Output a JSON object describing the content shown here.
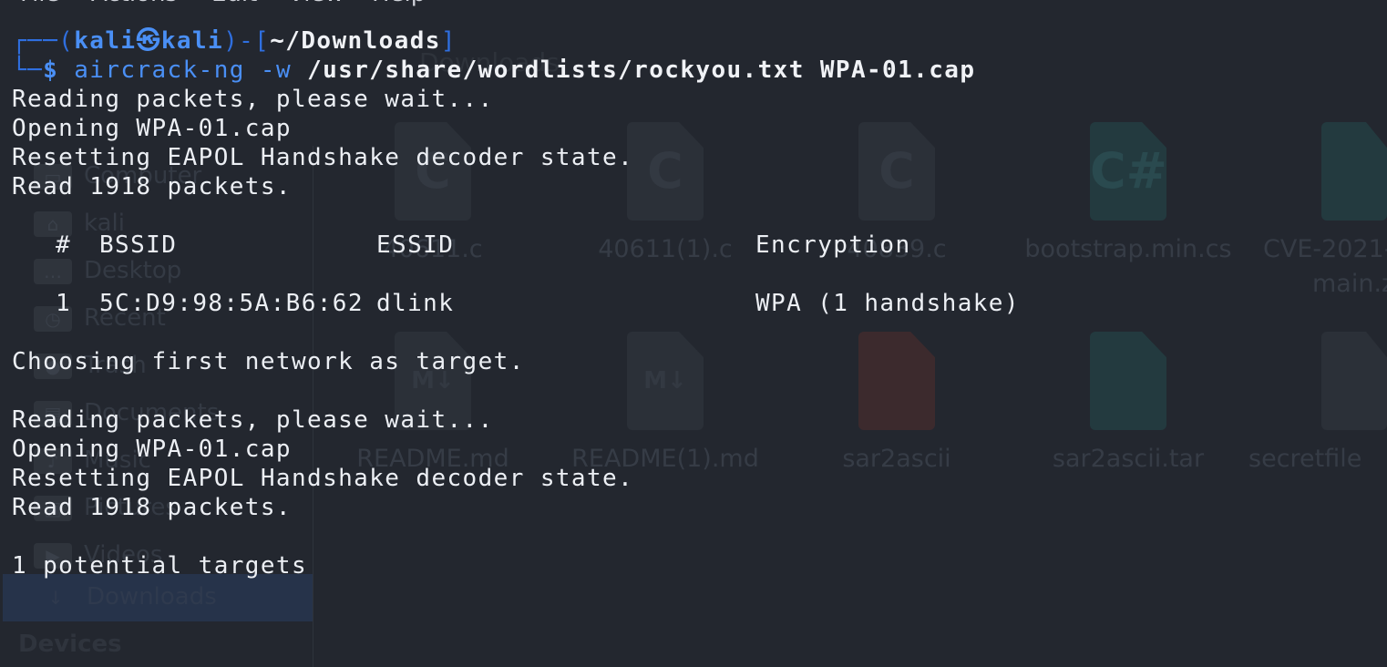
{
  "file_manager": {
    "breadcrumb": "Downloads",
    "sidebar": {
      "items": [
        {
          "label": "Computer",
          "icon": "computer-icon"
        },
        {
          "label": "kali",
          "icon": "home-folder-icon"
        },
        {
          "label": "Desktop",
          "icon": "desktop-folder-icon"
        },
        {
          "label": "Recent",
          "icon": "clock-icon"
        },
        {
          "label": "Trash",
          "icon": "trash-icon"
        },
        {
          "label": "Documents",
          "icon": "documents-folder-icon"
        },
        {
          "label": "Music",
          "icon": "music-folder-icon"
        },
        {
          "label": "Pictures",
          "icon": "pictures-folder-icon"
        },
        {
          "label": "Videos",
          "icon": "videos-folder-icon"
        },
        {
          "label": "Downloads",
          "icon": "download-icon",
          "selected": true
        }
      ],
      "heading_devices": "Devices"
    },
    "files": [
      {
        "name": "40611.c",
        "glyph": "C"
      },
      {
        "name": "40611(1).c",
        "glyph": "C"
      },
      {
        "name": "40839.c",
        "glyph": "C"
      },
      {
        "name": "bootstrap.min.cs",
        "glyph": "C#"
      },
      {
        "name": "CVE-2021-",
        "glyph": ""
      },
      {
        "name": "README.md",
        "glyph": "M↓"
      },
      {
        "name": "README(1).md",
        "glyph": "M↓"
      },
      {
        "name": "sar2ascii",
        "glyph": ""
      },
      {
        "name": "sar2ascii.tar",
        "glyph": ""
      },
      {
        "name": "secretfile",
        "glyph": ""
      }
    ],
    "files_extra": {
      "cve_second_line": "main.z"
    }
  },
  "terminal": {
    "menu": [
      "File",
      "Actions",
      "Edit",
      "View",
      "Help"
    ],
    "prompt": {
      "open": "┌──(",
      "user": "kali",
      "at": "㉿",
      "host": "kali",
      "mid": ")-[",
      "dir": "~/Downloads",
      "close": "]",
      "second": "└─",
      "dollar": "$"
    },
    "command": {
      "program": "aircrack-ng",
      "flag": "-w",
      "wordlist": "/usr/share/wordlists/rockyou.txt",
      "capture": "WPA-01.cap"
    },
    "block1": [
      "Reading packets, please wait...",
      "Opening WPA-01.cap",
      "Resetting EAPOL Handshake decoder state.",
      "Read 1918 packets."
    ],
    "table": {
      "headers": {
        "num": "#",
        "bssid": "BSSID",
        "essid": "ESSID",
        "encryption": "Encryption"
      },
      "rows": [
        {
          "num": "1",
          "bssid": "5C:D9:98:5A:B6:62",
          "essid": "dlink",
          "encryption": "WPA (1 handshake)"
        }
      ]
    },
    "choose_line": "Choosing first network as target.",
    "block2": [
      "Reading packets, please wait...",
      "Opening WPA-01.cap",
      "Resetting EAPOL Handshake decoder state.",
      "Read 1918 packets."
    ],
    "targets_line": "1 potential targets"
  },
  "colors": {
    "background": "#23272f",
    "prompt_blue": "#4a8ff5",
    "frame_blue": "#2f6fe0",
    "text": "#eceff4"
  }
}
